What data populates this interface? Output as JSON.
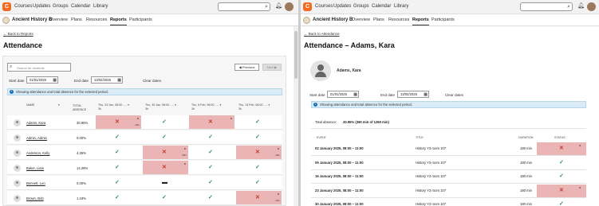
{
  "topnav": {
    "logo_text": "C",
    "items": [
      "Courses",
      "Updates",
      "Groups",
      "Calendar",
      "Library"
    ]
  },
  "course": {
    "title": "Ancient History B",
    "tabs": [
      "Overview",
      "Plans",
      "Resources",
      "Reports",
      "Participants"
    ],
    "active_tab": "Reports"
  },
  "left": {
    "back_link": "Back to Reports",
    "title": "Attendance",
    "search_placeholder": "Search for students",
    "previous": "Previous",
    "next": "Next",
    "start_label": "Start date",
    "start_value": "01/01/2025",
    "end_label": "End date",
    "end_value": "13/02/2025",
    "clear": "Clear dates",
    "info": "Showing attendance and total absence for the selected period.",
    "col_name": "NAME",
    "col_total": "TOTAL ABSENCE",
    "sessions": [
      {
        "label": "Thu, 23 Jan, 08:00 - ...",
        "duration": "3h"
      },
      {
        "label": "Thu, 30 Jan, 08:00 - ...",
        "duration": "3h"
      },
      {
        "label": "Thu, 6 Feb, 08:00 - ...",
        "duration": "3h"
      },
      {
        "label": "Thu, 13 Feb, 08:00 - ...",
        "duration": "3h"
      }
    ],
    "students": [
      {
        "name": "Adams, Kara",
        "total": "30.95%",
        "marks": [
          "x",
          "check",
          "x",
          "check"
        ],
        "mini": [
          "20m",
          "",
          "",
          ""
        ]
      },
      {
        "name": "Admin, Admin",
        "total": "0.00%",
        "marks": [
          "check",
          "check",
          "check",
          "check"
        ],
        "mini": [
          "",
          "",
          "",
          ""
        ]
      },
      {
        "name": "Anderson, Kelly",
        "total": "4.35%",
        "marks": [
          "check",
          "x",
          "check",
          "x"
        ],
        "mini": [
          "",
          "20m",
          "",
          "40m"
        ]
      },
      {
        "name": "Baker, Liam",
        "total": "14.29%",
        "marks": [
          "check",
          "x",
          "check",
          "check"
        ],
        "mini": [
          "",
          "",
          "",
          ""
        ]
      },
      {
        "name": "Bennett, Leo",
        "total": "0.00%",
        "marks": [
          "check",
          "dash",
          "check",
          "check"
        ],
        "mini": [
          "",
          "",
          "",
          ""
        ]
      },
      {
        "name": "Brown, Bob",
        "total": "1.19%",
        "marks": [
          "check",
          "check",
          "check",
          "x"
        ],
        "mini": [
          "",
          "",
          "",
          "13m"
        ]
      }
    ]
  },
  "right": {
    "back_link": "Back to Attendance",
    "title": "Attendance – Adams, Kara",
    "student_name": "Adams, Kara",
    "start_label": "Start date",
    "start_value": "01/01/2025",
    "end_label": "End date",
    "end_value": "13/02/2025",
    "clear": "Clear dates",
    "info": "Showing attendance and total absence for the selected period.",
    "total_label": "Total absence:",
    "total_value": "30.95% (390 min of 1260 min)",
    "col_event": "EVENT",
    "col_title": "TITLE",
    "col_duration": "DURATION",
    "col_status": "STATUS",
    "events": [
      {
        "event": "02 January 2025, 08:00 – 11:00",
        "title": "History Y3 room 107",
        "duration": "180 min",
        "status": "x"
      },
      {
        "event": "09 January 2025, 08:00 – 11:00",
        "title": "History Y3 room 107",
        "duration": "180 min",
        "status": "check"
      },
      {
        "event": "16 January 2025, 08:00 – 11:00",
        "title": "History Y3 room 107",
        "duration": "180 min",
        "status": "check"
      },
      {
        "event": "23 January 2025, 08:00 – 11:00",
        "title": "History Y3 room 107",
        "duration": "180 min",
        "status": "x"
      },
      {
        "event": "30 January 2025, 08:00 – 11:00",
        "title": "History Y3 room 107",
        "duration": "180 min",
        "status": "check"
      }
    ]
  },
  "colors": {
    "accent": "#f26b21",
    "absent": "#ebb5b5",
    "present": "#2f8a4f",
    "info_bg": "#d9ebf6"
  }
}
